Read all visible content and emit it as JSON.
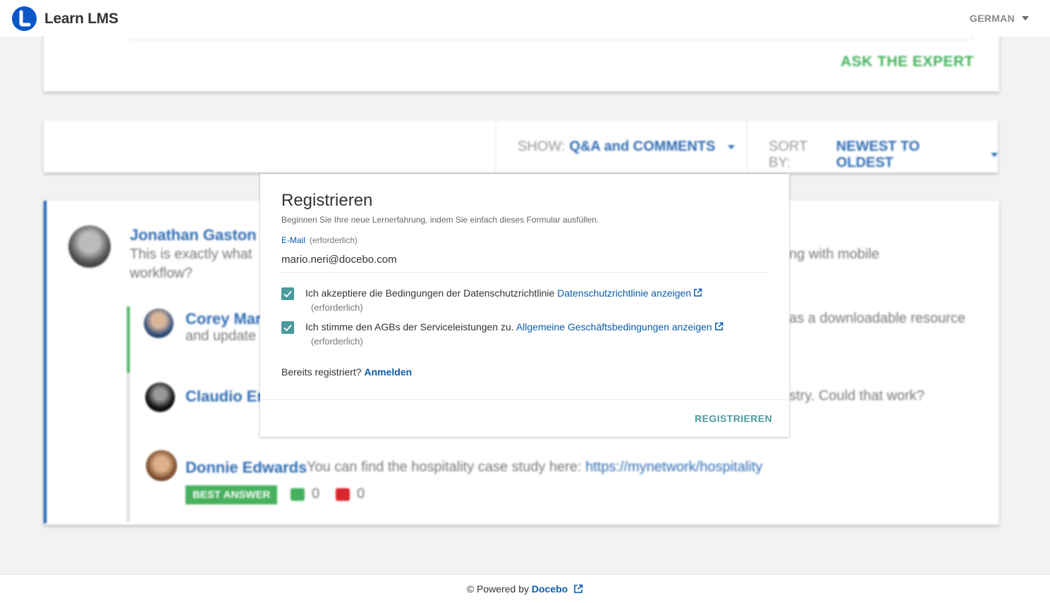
{
  "header": {
    "brand": "Learn LMS",
    "language": "GERMAN"
  },
  "background": {
    "ask_expert": "ASK THE EXPERT",
    "filters": {
      "show_label": "SHOW:",
      "show_value": "Q&A and COMMENTS",
      "sort_label": "SORT BY:",
      "sort_value": "NEWEST TO OLDEST"
    },
    "thread": {
      "posts": [
        {
          "author": "Jonathan Gaston",
          "line1_start": "This is exactly what",
          "line1_end": "ng with mobile",
          "line2": "workflow?"
        },
        {
          "author": "Corey Mar",
          "line1_end": "as a downloadable resource",
          "line2": "and update"
        },
        {
          "author": "Claudio Er",
          "line1_end": "stry.  Could that work?"
        },
        {
          "author": "Donnie Edwards",
          "text": "You can find the hospitality case study here:",
          "link": "https://mynetwork/hospitality"
        }
      ],
      "best_answer": "BEST ANSWER",
      "upvotes": "0",
      "downvotes": "0"
    }
  },
  "modal": {
    "title": "Registrieren",
    "subtitle": "Beginnen Sie Ihre neue Lernerfahrung, indem Sie einfach dieses Formular ausfüllen.",
    "email_label": "E-Mail",
    "required": "(erforderlich)",
    "email_value": "mario.neri@docebo.com",
    "privacy_text": "Ich akzeptiere die Bedingungen der Datenschutzrichtlinie",
    "privacy_link": "Datenschutzrichtlinie anzeigen",
    "terms_text": "Ich stimme den AGBs der Serviceleistungen zu.",
    "terms_link": "Allgemeine Geschäftsbedingungen anzeigen",
    "already_text": "Bereits registriert?",
    "login_link": "Anmelden",
    "submit": "REGISTRIEREN",
    "privacy_checked": true,
    "terms_checked": true
  },
  "footer": {
    "powered_by": "© Powered by",
    "vendor": "Docebo"
  },
  "colors": {
    "brand_blue": "#0b57c8",
    "link_blue": "#0b5cab",
    "teal": "#4a9a9e",
    "green": "#45b15d"
  }
}
